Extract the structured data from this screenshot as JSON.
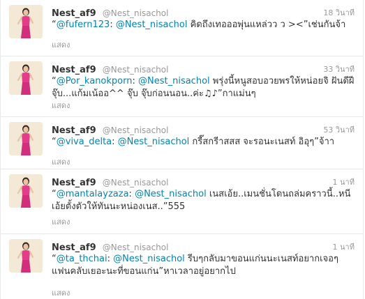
{
  "colors": {
    "link": "#0084b4",
    "name": "#333333",
    "muted": "#999999",
    "divider": "#e8e8e8"
  },
  "tweets": [
    {
      "name": "Nest_af9",
      "handle": "@Nest_nisachol",
      "time": "18 วินาที",
      "quote_open": "“",
      "mention1": "@fufern123",
      "sep": ": ",
      "mention2": "@Nest_nisachol",
      "body": " คิดถึงเทอออพุ่นแหล่วว ว ><”เช่นกันจ้า",
      "expand": "แสดง"
    },
    {
      "name": "Nest_af9",
      "handle": "@Nest_nisachol",
      "time": "33 วินาที",
      "quote_open": "“",
      "mention1": "@Por_kanokporn",
      "sep": ": ",
      "mention2": "@Nest_nisachol",
      "body": " พรุ่งนี้หนูสอบอวยพรให้หน่อยจิ ฝันดีฝีจุ๊บ...แก้มเน้ออ^^ จุ๊บ จุ๊บก่อนนอน..ค่ะ♫♪”กาแม่นๆ",
      "expand": "แสดง"
    },
    {
      "name": "Nest_af9",
      "handle": "@Nest_nisachol",
      "time": "53 วินาที",
      "quote_open": "“",
      "mention1": "@viva_delta",
      "sep": ": ",
      "mention2": "@Nest_nisachol",
      "body": " กรี๊สกรีาสสส จะรอนะเนสท์ อิอุๆ”จ้าา",
      "expand": "แสดง"
    },
    {
      "name": "Nest_af9",
      "handle": "@Nest_nisachol",
      "time": "1 นาที",
      "quote_open": "“",
      "mention1": "@mantalayzaza",
      "sep": ": ",
      "mention2": "@Nest_nisachol",
      "body": " เนสเอ้ย..เมนชั่นโดนถล่มคราวนี้..หนีเอ้ยตั้งตัวให้ทันนะหน่องเนส..”555",
      "expand": "แสดง"
    },
    {
      "name": "Nest_af9",
      "handle": "@Nest_nisachol",
      "time": "1 นาที",
      "quote_open": "“",
      "mention1": "@ta_thchai",
      "sep": ": ",
      "mention2": "@Nest_nisachol",
      "body": " รีบๆกลับมาขอนแก่นนะเนสท์อยากเจอๆ แฟนคลับเยอะนะที่ขอนแก่น”หาเวลาอยู่อยากไป",
      "expand": "แสดง"
    }
  ]
}
